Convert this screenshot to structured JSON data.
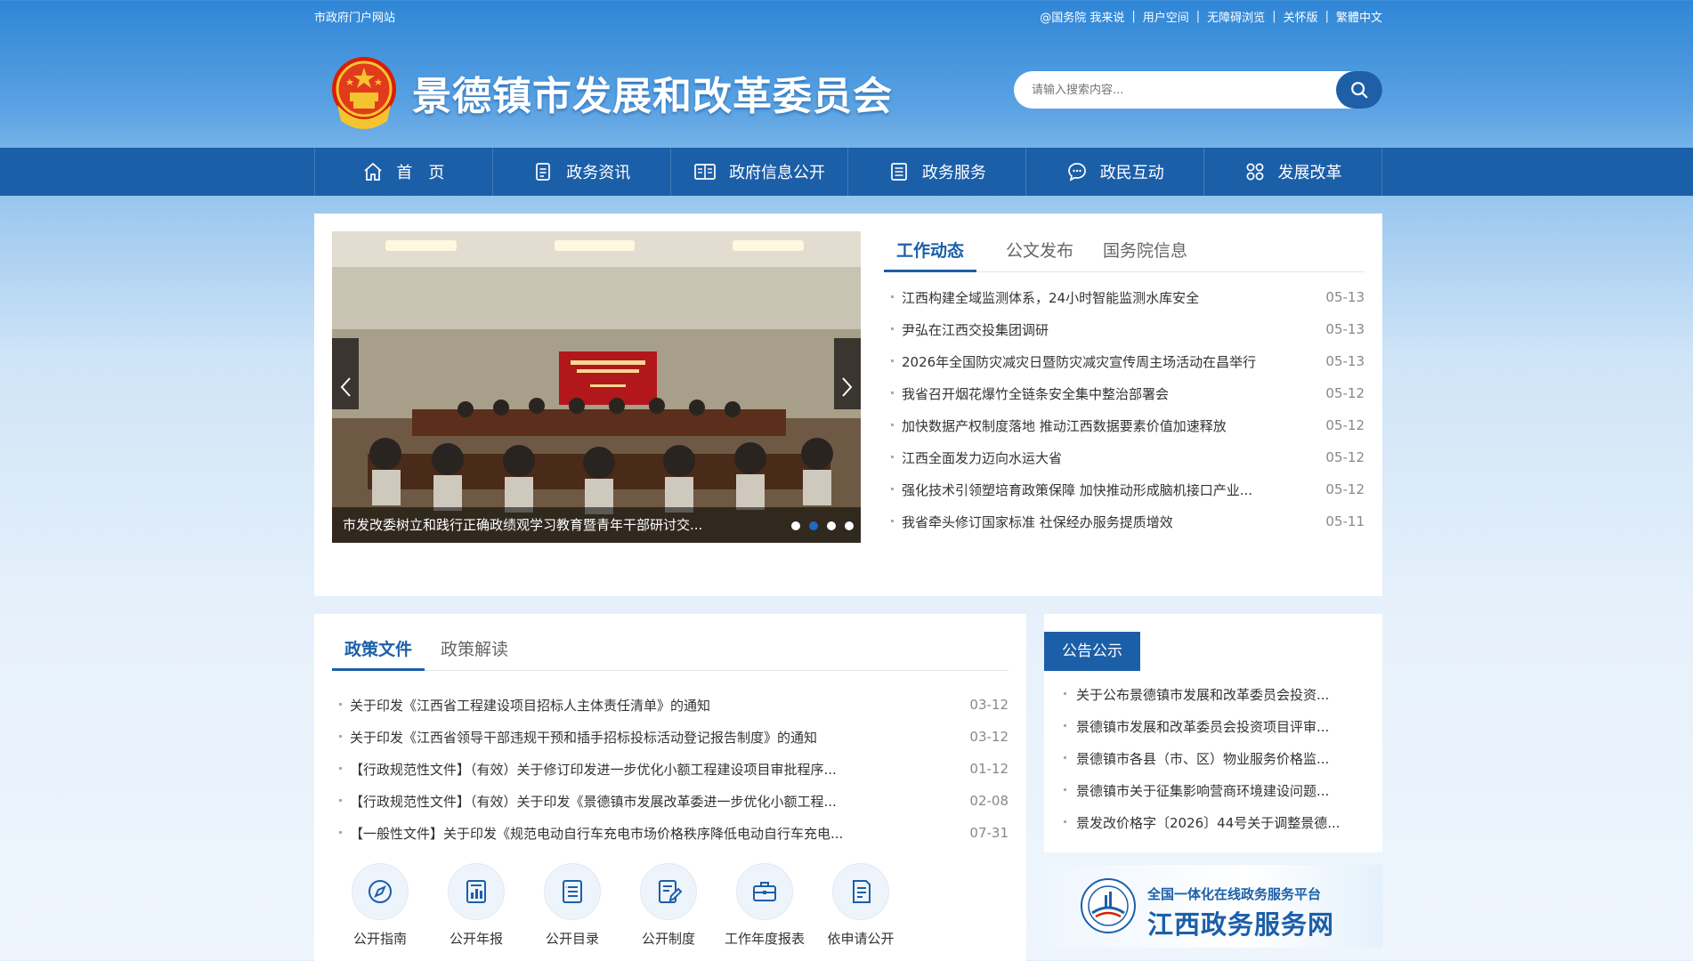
{
  "topbar": {
    "left": "市政府门户网站",
    "links": [
      "@国务院 我来说",
      "用户空间",
      "无障碍浏览",
      "关怀版",
      "繁體中文"
    ]
  },
  "header": {
    "title": "景德镇市发展和改革委员会",
    "search_placeholder": "请输入搜索内容..."
  },
  "nav": [
    {
      "label": "首　页",
      "icon": "home-icon"
    },
    {
      "label": "政务资讯",
      "icon": "document-icon"
    },
    {
      "label": "政府信息公开",
      "icon": "book-icon"
    },
    {
      "label": "政务服务",
      "icon": "list-icon"
    },
    {
      "label": "政民互动",
      "icon": "chat-icon"
    },
    {
      "label": "发展改革",
      "icon": "grid-icon"
    }
  ],
  "slider": {
    "caption": "市发改委树立和践行正确政绩观学习教育暨青年干部研讨交...",
    "dots": 4,
    "active_dot": 2
  },
  "news": {
    "tabs": [
      "工作动态",
      "公文发布",
      "国务院信息"
    ],
    "items": [
      {
        "title": "江西构建全域监测体系，24小时智能监测水库安全",
        "date": "05-13"
      },
      {
        "title": "尹弘在江西交投集团调研",
        "date": "05-13"
      },
      {
        "title": "2026年全国防灾减灾日暨防灾减灾宣传周主场活动在昌举行",
        "date": "05-13"
      },
      {
        "title": "我省召开烟花爆竹全链条安全集中整治部署会",
        "date": "05-12"
      },
      {
        "title": "加快数据产权制度落地 推动江西数据要素价值加速释放",
        "date": "05-12"
      },
      {
        "title": "江西全面发力迈向水运大省",
        "date": "05-12"
      },
      {
        "title": "强化技术引领塑培育政策保障 加快推动形成脑机接口产业...",
        "date": "05-12"
      },
      {
        "title": "我省牵头修订国家标准 社保经办服务提质增效",
        "date": "05-11"
      }
    ]
  },
  "policy": {
    "tabs": [
      "政策文件",
      "政策解读"
    ],
    "items": [
      {
        "title": "关于印发《江西省工程建设项目招标人主体责任清单》的通知",
        "date": "03-12"
      },
      {
        "title": "关于印发《江西省领导干部违规干预和插手招标投标活动登记报告制度》的通知",
        "date": "03-12"
      },
      {
        "title": "【行政规范性文件】（有效）关于修订印发进一步优化小额工程建设项目审批程序...",
        "date": "01-12"
      },
      {
        "title": "【行政规范性文件】（有效）关于印发《景德镇市发展改革委进一步优化小额工程...",
        "date": "02-08"
      },
      {
        "title": "【一般性文件】关于印发《规范电动自行车充电市场价格秩序降低电动自行车充电...",
        "date": "07-31"
      }
    ],
    "quick_links": [
      {
        "label": "公开指南",
        "icon": "compass-icon"
      },
      {
        "label": "公开年报",
        "icon": "bar-report-icon"
      },
      {
        "label": "公开目录",
        "icon": "catalog-icon"
      },
      {
        "label": "公开制度",
        "icon": "edit-doc-icon"
      },
      {
        "label": "工作年度报表",
        "icon": "briefcase-icon"
      },
      {
        "label": "依申请公开",
        "icon": "apply-doc-icon"
      }
    ]
  },
  "announcements": {
    "tab": "公告公示",
    "items": [
      "关于公布景德镇市发展和改革委员会投资...",
      "景德镇市发展和改革委员会投资项目评审...",
      "景德镇市各县（市、区）物业服务价格监...",
      "景德镇市关于征集影响营商环境建设问题...",
      "景发改价格字〔2026〕44号关于调整景德..."
    ]
  },
  "banner": {
    "line1": "全国一体化在线政务服务平台",
    "line2": "江西政务服务网"
  },
  "colors": {
    "primary": "#1c5fa9",
    "accent": "#1c6cc4"
  }
}
